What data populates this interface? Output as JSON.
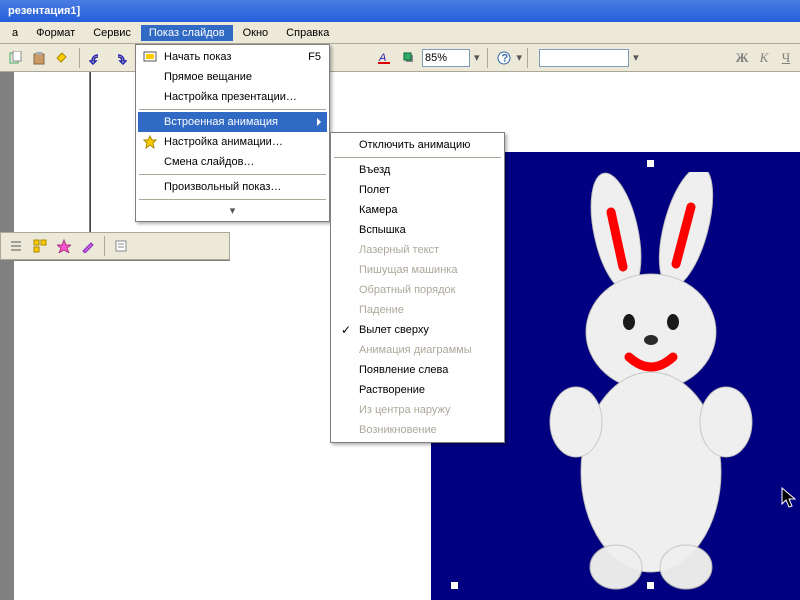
{
  "title": "резентация1]",
  "menubar": {
    "format": "Формат",
    "service": "Сервис",
    "slideshow": "Показ слайдов",
    "window": "Окно",
    "help": "Справка"
  },
  "toolbar": {
    "zoom": "85%"
  },
  "format_buttons": {
    "bold": "Ж",
    "italic": "К",
    "underline": "Ч"
  },
  "primary_menu": {
    "start_show": "Начать показ",
    "start_show_sc": "F5",
    "broadcast": "Прямое вещание",
    "setup_show": "Настройка презентации…",
    "preset_anim": "Встроенная анимация",
    "custom_anim": "Настройка анимации…",
    "slide_trans": "Смена слайдов…",
    "custom_show": "Произвольный показ…"
  },
  "sub_menu": {
    "disable": "Отключить анимацию",
    "drive_in": "Въезд",
    "fly": "Полет",
    "camera": "Камера",
    "flash": "Вспышка",
    "laser_text": "Лазерный текст",
    "typewriter": "Пишущая машинка",
    "reverse_order": "Обратный порядок",
    "drop": "Падение",
    "fly_from_top": "Вылет сверху",
    "chart_anim": "Анимация диаграммы",
    "appear_left": "Появление слева",
    "dissolve": "Растворение",
    "center_out": "Из центра наружу",
    "appear": "Возникновение"
  }
}
